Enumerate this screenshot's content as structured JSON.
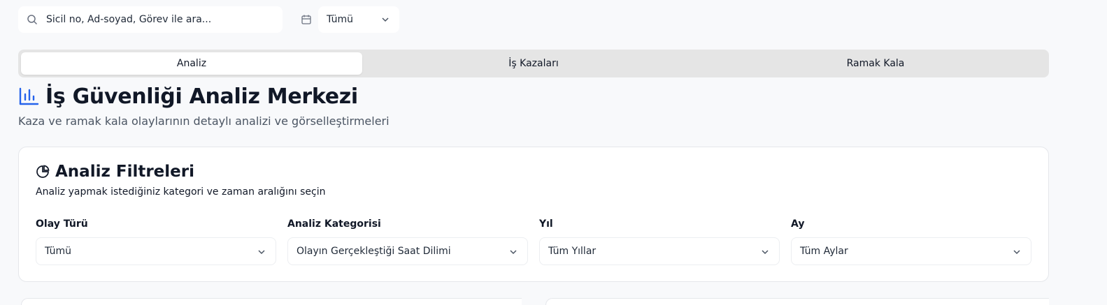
{
  "search": {
    "placeholder": "Sicil no, Ad-soyad, Görev ile ara..."
  },
  "date_filter": {
    "value": "Tümü"
  },
  "tabs": [
    {
      "label": "Analiz",
      "active": true
    },
    {
      "label": "İş Kazaları",
      "active": false
    },
    {
      "label": "Ramak Kala",
      "active": false
    }
  ],
  "header": {
    "title": "İş Güvenliği Analiz Merkezi",
    "subtitle": "Kaza ve ramak kala olaylarının detaylı analizi ve görselleştirmeleri"
  },
  "filters_card": {
    "title": "Analiz Filtreleri",
    "description": "Analiz yapmak istediğiniz kategori ve zaman aralığını seçin",
    "fields": [
      {
        "label": "Olay Türü",
        "value": "Tümü"
      },
      {
        "label": "Analiz Kategorisi",
        "value": "Olayın Gerçekleştiği Saat Dilimi"
      },
      {
        "label": "Yıl",
        "value": "Tüm Yıllar"
      },
      {
        "label": "Ay",
        "value": "Tüm Aylar"
      }
    ]
  },
  "colors": {
    "accent": "#2563eb",
    "text": "#111827",
    "muted": "#4b5563",
    "tab_track": "#e5e5e5",
    "background": "#f8f9fb"
  }
}
